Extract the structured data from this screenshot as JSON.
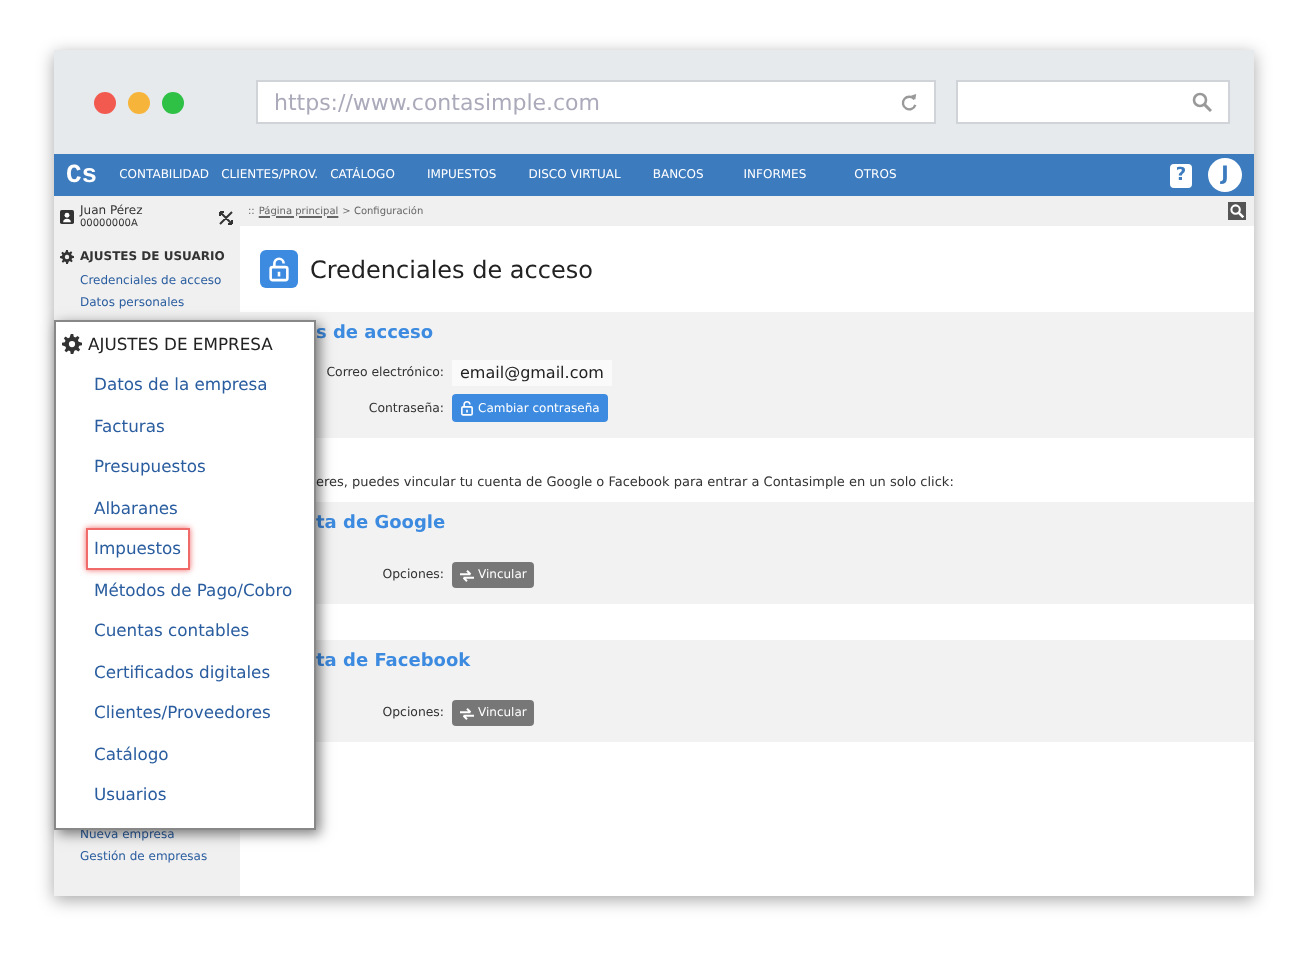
{
  "browser": {
    "url_placeholder": "https://www.contasimple.com"
  },
  "nav": {
    "logo": "Cs",
    "items": [
      "CONTABILIDAD",
      "CLIENTES/PROV.",
      "CATÁLOGO",
      "IMPUESTOS",
      "DISCO VIRTUAL",
      "BANCOS",
      "INFORMES",
      "OTROS"
    ],
    "help": "?",
    "avatar": "J"
  },
  "user": {
    "name": "Juan Pérez",
    "id": "00000000A"
  },
  "breadcrumb": {
    "separator": "::",
    "link": "Página principal",
    "current": "> Configuración"
  },
  "sidebar": {
    "user_section": "AJUSTES DE USUARIO",
    "user_items": [
      "Credenciales de acceso",
      "Datos personales"
    ],
    "bottom_items": [
      "Nueva empresa",
      "Gestión de empresas"
    ]
  },
  "company_menu": {
    "title": "AJUSTES DE EMPRESA",
    "items": [
      {
        "label": "Datos de la empresa",
        "selected": false
      },
      {
        "label": "Facturas",
        "selected": false
      },
      {
        "label": "Presupuestos",
        "selected": false
      },
      {
        "label": "Albaranes",
        "selected": false
      },
      {
        "label": "Impuestos",
        "selected": true
      },
      {
        "label": "Métodos de Pago/Cobro",
        "selected": false
      },
      {
        "label": "Cuentas contables",
        "selected": false
      },
      {
        "label": "Certificados digitales",
        "selected": false
      },
      {
        "label": "Clientes/Proveedores",
        "selected": false
      },
      {
        "label": "Catálogo",
        "selected": false
      },
      {
        "label": "Usuarios",
        "selected": false
      }
    ]
  },
  "page": {
    "title": "Credenciales de acceso",
    "access": {
      "title": "s de acceso",
      "email_label": "Correo electrónico:",
      "email": "email@gmail.com",
      "password_label": "Contraseña:",
      "password_button": "Cambiar contraseña"
    },
    "info": "eres, puedes vincular tu cuenta de Google o Facebook para entrar a Contasimple en un solo click:",
    "links": [
      {
        "title": "ta de Google",
        "label": "Opciones:",
        "button": "Vincular"
      },
      {
        "title": "ta de Facebook",
        "label": "Opciones:",
        "button": "Vincular"
      }
    ]
  }
}
